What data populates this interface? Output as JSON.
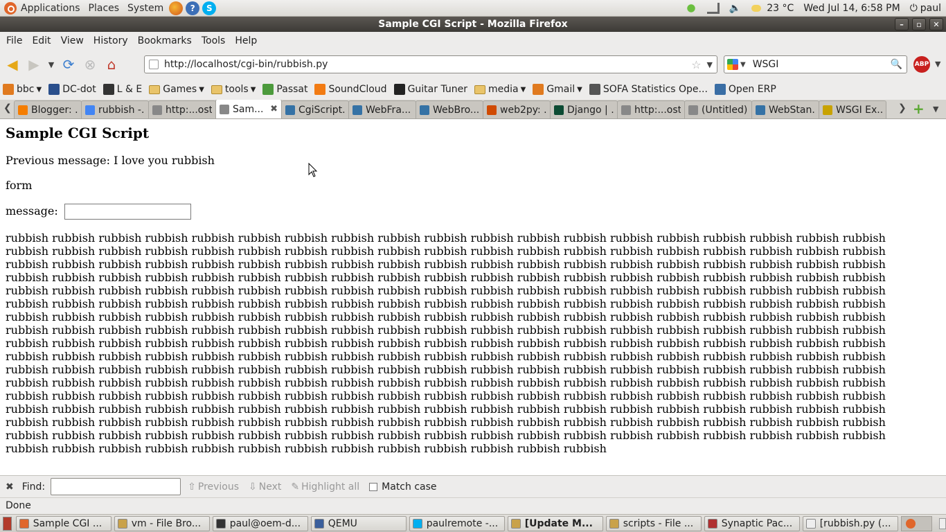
{
  "top_panel": {
    "menus": [
      "Applications",
      "Places",
      "System"
    ],
    "temperature": "23 °C",
    "datetime": "Wed Jul 14,  6:58 PM",
    "user": "paul"
  },
  "window": {
    "title": "Sample CGI Script - Mozilla Firefox"
  },
  "menubar": [
    "File",
    "Edit",
    "View",
    "History",
    "Bookmarks",
    "Tools",
    "Help"
  ],
  "navbar": {
    "url": "http://localhost/cgi-bin/rubbish.py",
    "search_value": "WSGI",
    "adblock_label": "ABP"
  },
  "bookmarks": [
    {
      "label": "bbc",
      "folder": false,
      "dropdown": true,
      "color": "#e07a1f"
    },
    {
      "label": "DC-dot",
      "folder": false,
      "dropdown": false,
      "color": "#2a4f8c"
    },
    {
      "label": "L & E",
      "folder": false,
      "dropdown": false,
      "color": "#333333"
    },
    {
      "label": "Games",
      "folder": true,
      "dropdown": true,
      "color": "#e9c46a"
    },
    {
      "label": "tools",
      "folder": true,
      "dropdown": true,
      "color": "#e9c46a"
    },
    {
      "label": "Passat",
      "folder": false,
      "dropdown": false,
      "color": "#4c9a3c"
    },
    {
      "label": "SoundCloud",
      "folder": false,
      "dropdown": false,
      "color": "#f27b13"
    },
    {
      "label": "Guitar Tuner",
      "folder": false,
      "dropdown": false,
      "color": "#222222"
    },
    {
      "label": "media",
      "folder": true,
      "dropdown": true,
      "color": "#e9c46a"
    },
    {
      "label": "Gmail",
      "folder": false,
      "dropdown": true,
      "color": "#e07a1f"
    },
    {
      "label": "SOFA Statistics Ope...",
      "folder": false,
      "dropdown": false,
      "color": "#555555"
    },
    {
      "label": "Open ERP",
      "folder": false,
      "dropdown": false,
      "color": "#3a6ea5"
    }
  ],
  "tabs": [
    {
      "label": "Blogger: ...",
      "active": false,
      "color": "#f57d00"
    },
    {
      "label": "rubbish -...",
      "active": false,
      "color": "#4285f4"
    },
    {
      "label": "http:...ost/",
      "active": false,
      "color": "#888888"
    },
    {
      "label": "Sam...",
      "active": true,
      "color": "#888888"
    },
    {
      "label": "CgiScript...",
      "active": false,
      "color": "#3572a5"
    },
    {
      "label": "WebFra...",
      "active": false,
      "color": "#3572a5"
    },
    {
      "label": "WebBro...",
      "active": false,
      "color": "#3572a5"
    },
    {
      "label": "web2py: ...",
      "active": false,
      "color": "#d04a02"
    },
    {
      "label": "Django | ...",
      "active": false,
      "color": "#0c4b33"
    },
    {
      "label": "http:...ost/",
      "active": false,
      "color": "#888888"
    },
    {
      "label": "(Untitled)",
      "active": false,
      "color": "#888888"
    },
    {
      "label": "WebStan...",
      "active": false,
      "color": "#3572a5"
    },
    {
      "label": "WSGI Ex...",
      "active": false,
      "color": "#c8a200"
    }
  ],
  "page": {
    "heading": "Sample CGI Script",
    "previous_message": "Previous message: I love you rubbish",
    "form_label": "form",
    "message_label": "message:",
    "message_value": "",
    "body_text": "rubbish rubbish rubbish rubbish rubbish rubbish rubbish rubbish rubbish rubbish rubbish rubbish rubbish rubbish rubbish rubbish rubbish rubbish rubbish rubbish rubbish rubbish rubbish rubbish rubbish rubbish rubbish rubbish rubbish rubbish rubbish rubbish rubbish rubbish rubbish rubbish rubbish rubbish rubbish rubbish rubbish rubbish rubbish rubbish rubbish rubbish rubbish rubbish rubbish rubbish rubbish rubbish rubbish rubbish rubbish rubbish rubbish rubbish rubbish rubbish rubbish rubbish rubbish rubbish rubbish rubbish rubbish rubbish rubbish rubbish rubbish rubbish rubbish rubbish rubbish rubbish rubbish rubbish rubbish rubbish rubbish rubbish rubbish rubbish rubbish rubbish rubbish rubbish rubbish rubbish rubbish rubbish rubbish rubbish rubbish rubbish rubbish rubbish rubbish rubbish rubbish rubbish rubbish rubbish rubbish rubbish rubbish rubbish rubbish rubbish rubbish rubbish rubbish rubbish rubbish rubbish rubbish rubbish rubbish rubbish rubbish rubbish rubbish rubbish rubbish rubbish rubbish rubbish rubbish rubbish rubbish rubbish rubbish rubbish rubbish rubbish rubbish rubbish rubbish rubbish rubbish rubbish rubbish rubbish rubbish rubbish rubbish rubbish rubbish rubbish rubbish rubbish rubbish rubbish rubbish rubbish rubbish rubbish rubbish rubbish rubbish rubbish rubbish rubbish rubbish rubbish rubbish rubbish rubbish rubbish rubbish rubbish rubbish rubbish rubbish rubbish rubbish rubbish rubbish rubbish rubbish rubbish rubbish rubbish rubbish rubbish rubbish rubbish rubbish rubbish rubbish rubbish rubbish rubbish rubbish rubbish rubbish rubbish rubbish rubbish rubbish rubbish rubbish rubbish rubbish rubbish rubbish rubbish rubbish rubbish rubbish rubbish rubbish rubbish rubbish rubbish rubbish rubbish rubbish rubbish rubbish rubbish rubbish rubbish rubbish rubbish rubbish rubbish rubbish rubbish rubbish rubbish rubbish rubbish rubbish rubbish rubbish rubbish rubbish rubbish rubbish rubbish rubbish rubbish rubbish rubbish rubbish rubbish rubbish rubbish rubbish rubbish rubbish rubbish rubbish rubbish rubbish rubbish rubbish rubbish rubbish rubbish rubbish rubbish rubbish rubbish rubbish rubbish rubbish rubbish rubbish rubbish rubbish rubbish rubbish rubbish rubbish rubbish rubbish rubbish rubbish rubbish rubbish rubbish rubbish rubbish rubbish rubbish rubbish rubbish rubbish rubbish rubbish rubbish rubbish rubbish rubbish rubbish rubbish rubbish rubbish rubbish rubbish rubbish rubbish rubbish rubbish rubbish rubbish rubbish rubbish rubbish rubbish rubbish rubbish rubbish rubbish"
  },
  "findbar": {
    "label": "Find:",
    "value": "",
    "previous": "Previous",
    "next": "Next",
    "highlight": "Highlight all",
    "match_case": "Match case"
  },
  "status": "Done",
  "taskbar": [
    {
      "label": "Sample CGI ...",
      "bold": false,
      "color": "#e0662b"
    },
    {
      "label": "vm - File Bro...",
      "bold": false,
      "color": "#c9a24a"
    },
    {
      "label": "paul@oem-d...",
      "bold": false,
      "color": "#333333"
    },
    {
      "label": "QEMU",
      "bold": false,
      "color": "#3a5f9c"
    },
    {
      "label": "paulremote -...",
      "bold": false,
      "color": "#00aff0"
    },
    {
      "label": "[Update M...",
      "bold": true,
      "color": "#c9a24a"
    },
    {
      "label": "scripts - File ...",
      "bold": false,
      "color": "#c9a24a"
    },
    {
      "label": "Synaptic Pac...",
      "bold": false,
      "color": "#b03030"
    },
    {
      "label": "[rubbish.py (...",
      "bold": false,
      "color": "#eeeeee"
    }
  ]
}
